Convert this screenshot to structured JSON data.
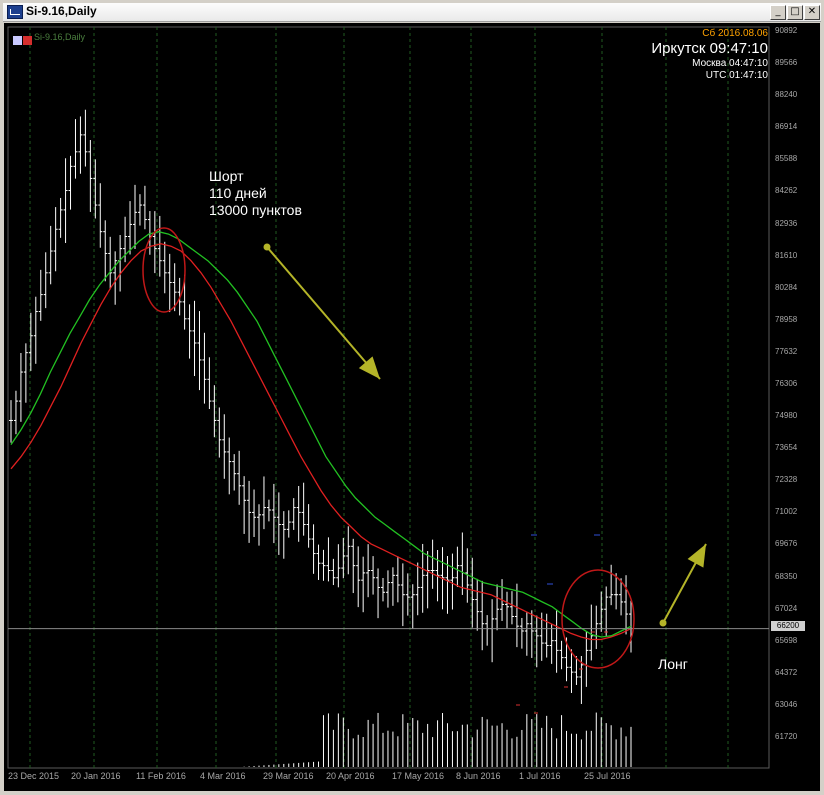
{
  "window": {
    "title": "Si-9.16,Daily",
    "buttons": {
      "minimize": "_",
      "maximize": "□",
      "close": "✕"
    }
  },
  "symbol_label": "Si-9.16,Daily",
  "clock": {
    "date": "Сб 2016.08.06",
    "irkutsk": "Иркутск 09:47:10",
    "moscow": "Москва 04:47:10",
    "utc": "UTC 01:47:10"
  },
  "annotations": {
    "short_lines": [
      "Шорт",
      "110 дней",
      "13000 пунктов"
    ],
    "long": "Лонг"
  },
  "current_price": "66200",
  "colors": {
    "background": "#000000",
    "bars": "#ffffff",
    "ma_fast": "#22c022",
    "ma_slow": "#e02020",
    "arrow": "#b4b428",
    "circle": "#c01818",
    "grid": "#1f5a1f"
  },
  "chart_data": {
    "type": "ohlc",
    "y_ticks": [
      "90892",
      "89566",
      "88240",
      "86914",
      "85588",
      "84262",
      "82936",
      "81610",
      "80284",
      "78958",
      "77632",
      "76306",
      "74980",
      "73654",
      "72328",
      "71002",
      "69676",
      "68350",
      "67024",
      "65698",
      "64372",
      "63046",
      "61720"
    ],
    "x_ticks": [
      "23 Dec 2015",
      "20 Jan 2016",
      "11 Feb 2016",
      "4 Mar 2016",
      "29 Mar 2016",
      "20 Apr 2016",
      "17 May 2016",
      "8 Jun 2016",
      "1 Jul 2016",
      "25 Jul 2016"
    ],
    "ylim": [
      60800,
      91300
    ],
    "close_series": [
      74800,
      75600,
      76800,
      77600,
      78300,
      79300,
      80000,
      80900,
      81800,
      82700,
      83500,
      84300,
      85300,
      85900,
      86600,
      85900,
      84800,
      83700,
      82600,
      81700,
      80900,
      81400,
      81900,
      82400,
      82900,
      83400,
      83700,
      83100,
      82400,
      81900,
      81400,
      80900,
      80500,
      80100,
      79700,
      79000,
      78500,
      78000,
      77300,
      76500,
      75600,
      74800,
      74000,
      73500,
      73100,
      72600,
      72100,
      71500,
      71000,
      70800,
      70900,
      71200,
      71100,
      70800,
      70500,
      70300,
      70600,
      71200,
      71000,
      70500,
      69900,
      69300,
      68900,
      68800,
      68600,
      68300,
      68700,
      69200,
      69600,
      68800,
      68200,
      68500,
      68600,
      68300,
      67900,
      67700,
      68100,
      68400,
      68000,
      67600,
      67500,
      67600,
      67900,
      68400,
      68600,
      68600,
      68400,
      68300,
      68200,
      68300,
      68800,
      68500,
      68000,
      67400,
      66900,
      66400,
      66200,
      66600,
      67000,
      67200,
      67100,
      66700,
      66300,
      66100,
      66400,
      66100,
      65900,
      65600,
      65500,
      65700,
      65300,
      65000,
      64600,
      64400,
      64200,
      64700,
      65300,
      65900,
      66400,
      67000,
      67500,
      67600,
      67600,
      67300,
      66800,
      66200
    ],
    "ma_fast": {
      "name": "",
      "values": [
        73800,
        74400,
        75100,
        75900,
        76800,
        77600,
        78400,
        79100,
        79800,
        80400,
        80900,
        81400,
        81800,
        82200,
        82500,
        82600,
        82500,
        82300,
        82000,
        81700,
        81400,
        81000,
        80600,
        80100,
        79500,
        78900,
        78100,
        77300,
        76500,
        75700,
        74900,
        74100,
        73300,
        72700,
        72100,
        71600,
        71200,
        70800,
        70500,
        70200,
        69900,
        69600,
        69300,
        69100,
        68900,
        68700,
        68500,
        68300,
        68100,
        68000,
        67900,
        67800,
        67700,
        67500,
        67300,
        67100,
        66800,
        66500,
        66200,
        65950,
        65850,
        65900,
        66100,
        66300
      ]
    },
    "ma_slow": {
      "name": "",
      "values": [
        72800,
        73300,
        73900,
        74600,
        75400,
        76200,
        77100,
        78000,
        78800,
        79600,
        80300,
        80900,
        81400,
        81800,
        82000,
        82100,
        82000,
        81800,
        81400,
        80900,
        80300,
        79600,
        78900,
        78100,
        77300,
        76500,
        75700,
        74900,
        74100,
        73300,
        72600,
        71900,
        71300,
        70800,
        70400,
        70000,
        69700,
        69500,
        69300,
        69100,
        68900,
        68700,
        68500,
        68300,
        68100,
        67900,
        67800,
        67700,
        67600,
        67400,
        67200,
        67000,
        66800,
        66600,
        66400,
        66200,
        66000,
        65850,
        65750,
        65750,
        65850,
        66000,
        66200
      ]
    },
    "volume": "increasing from Jun 2016 to Jul 2016"
  }
}
